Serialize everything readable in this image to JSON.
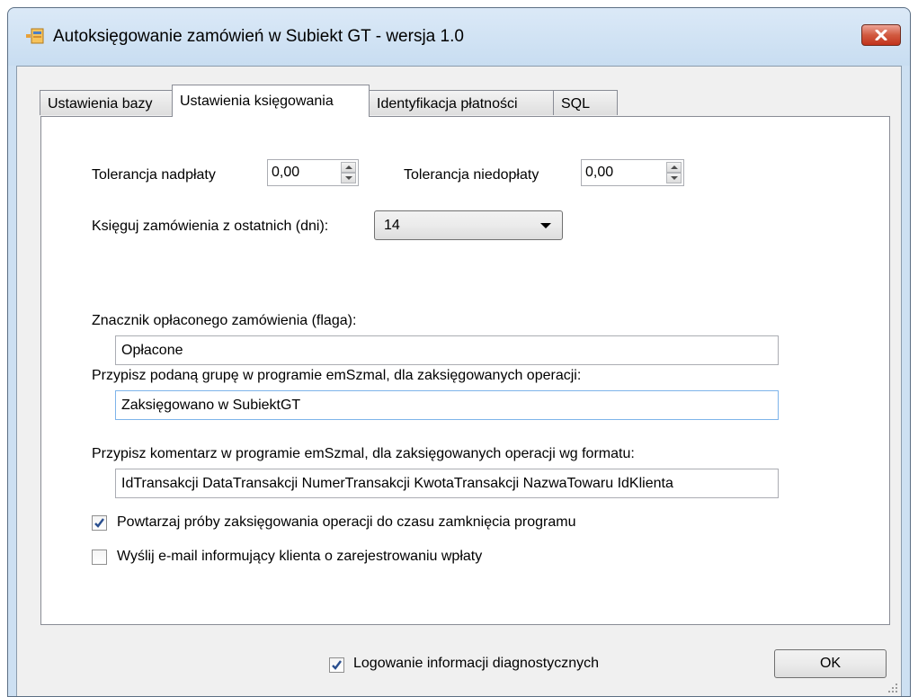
{
  "window": {
    "title": "Autoksięgowanie zamówień w Subiekt GT - wersja 1.0",
    "close_icon": "close-icon"
  },
  "tabs": [
    {
      "label": "Ustawienia bazy",
      "active": false
    },
    {
      "label": "Ustawienia księgowania",
      "active": true
    },
    {
      "label": "Identyfikacja płatności",
      "active": false
    },
    {
      "label": "SQL",
      "active": false
    }
  ],
  "settings": {
    "overpay_label": "Tolerancja nadpłaty",
    "overpay_value": "0,00",
    "underpay_label": "Tolerancja niedopłaty",
    "underpay_value": "0,00",
    "days_label": "Księguj zamówienia z ostatnich (dni):",
    "days_value": "14",
    "flag_label": "Znacznik opłaconego zamówienia (flaga):",
    "flag_value": "Opłacone",
    "group_label": "Przypisz podaną grupę w programie emSzmal, dla zaksięgowanych operacji:",
    "group_value": "Zaksięgowano w SubiektGT",
    "comment_label": "Przypisz komentarz w programie emSzmal, dla zaksięgowanych operacji wg formatu:",
    "comment_value": "IdTransakcji DataTransakcji NumerTransakcji KwotaTransakcji NazwaTowaru IdKlienta",
    "retry_label": "Powtarzaj próby zaksięgowania operacji do czasu zamknięcia programu",
    "retry_checked": true,
    "email_label": "Wyślij e-mail informujący klienta o zarejestrowaniu wpłaty",
    "email_checked": false
  },
  "footer": {
    "diag_label": "Logowanie informacji diagnostycznych",
    "diag_checked": true,
    "ok_label": "OK"
  },
  "colors": {
    "title_bar": "#cde0f2",
    "client_bg": "#f0f0f0",
    "close_button": "#c2331c",
    "check_mark": "#2a4f8f"
  }
}
